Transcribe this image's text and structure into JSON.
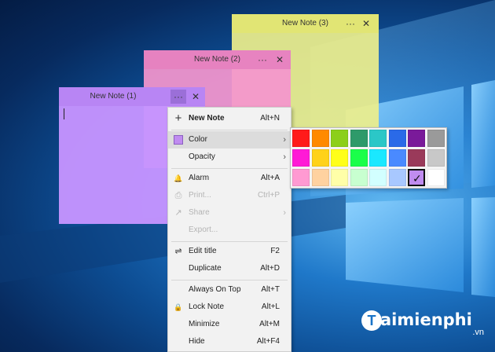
{
  "notes": [
    {
      "title": "New Note (3)",
      "more_glyph": "···",
      "close_glyph": "✕"
    },
    {
      "title": "New Note (2)",
      "more_glyph": "···",
      "close_glyph": "✕"
    },
    {
      "title": "New Note (1)",
      "more_glyph": "···",
      "close_glyph": "✕"
    }
  ],
  "menu": {
    "items": [
      {
        "label": "New Note",
        "shortcut": "Alt+N",
        "icon": "plus-icon",
        "glyph": "+"
      },
      {
        "label": "Color",
        "icon": "color-swatch-icon",
        "arrow": "›"
      },
      {
        "label": "Opacity",
        "arrow": "›"
      },
      {
        "label": "Alarm",
        "shortcut": "Alt+A",
        "icon": "bell-icon",
        "glyph": "🔔"
      },
      {
        "label": "Print...",
        "shortcut": "Ctrl+P",
        "icon": "printer-icon",
        "glyph": "⎙"
      },
      {
        "label": "Share",
        "icon": "share-icon",
        "glyph": "↗",
        "arrow": "›"
      },
      {
        "label": "Export..."
      },
      {
        "label": "Edit title",
        "shortcut": "F2",
        "icon": "edit-title-icon",
        "glyph": "⇌"
      },
      {
        "label": "Duplicate",
        "shortcut": "Alt+D"
      },
      {
        "label": "Always On Top",
        "shortcut": "Alt+T"
      },
      {
        "label": "Lock Note",
        "shortcut": "Alt+L",
        "icon": "lock-icon",
        "glyph": "🔒"
      },
      {
        "label": "Minimize",
        "shortcut": "Alt+M"
      },
      {
        "label": "Hide",
        "shortcut": "Alt+F4"
      }
    ]
  },
  "palette": {
    "colors": [
      "#ff1a1a",
      "#ff8a00",
      "#8ccf1a",
      "#2e9a6a",
      "#2bc7c7",
      "#2a6ae8",
      "#7a1a9a",
      "#9a9a9a",
      "#ff1ad6",
      "#ffd21a",
      "#ffff1a",
      "#1aff4a",
      "#1ae8ff",
      "#4a8aff",
      "#9a3a5a",
      "#c8c8c8",
      "#ff9ad2",
      "#ffd2a0",
      "#ffffa8",
      "#c8ffd0",
      "#d2ffff",
      "#a8c8ff",
      "#c08cf0",
      "#ffffff"
    ],
    "selected_index": 22,
    "check_glyph": "✓"
  },
  "watermark": {
    "brand": "aimienphi",
    "initial": "T",
    "tld": ".vn"
  }
}
